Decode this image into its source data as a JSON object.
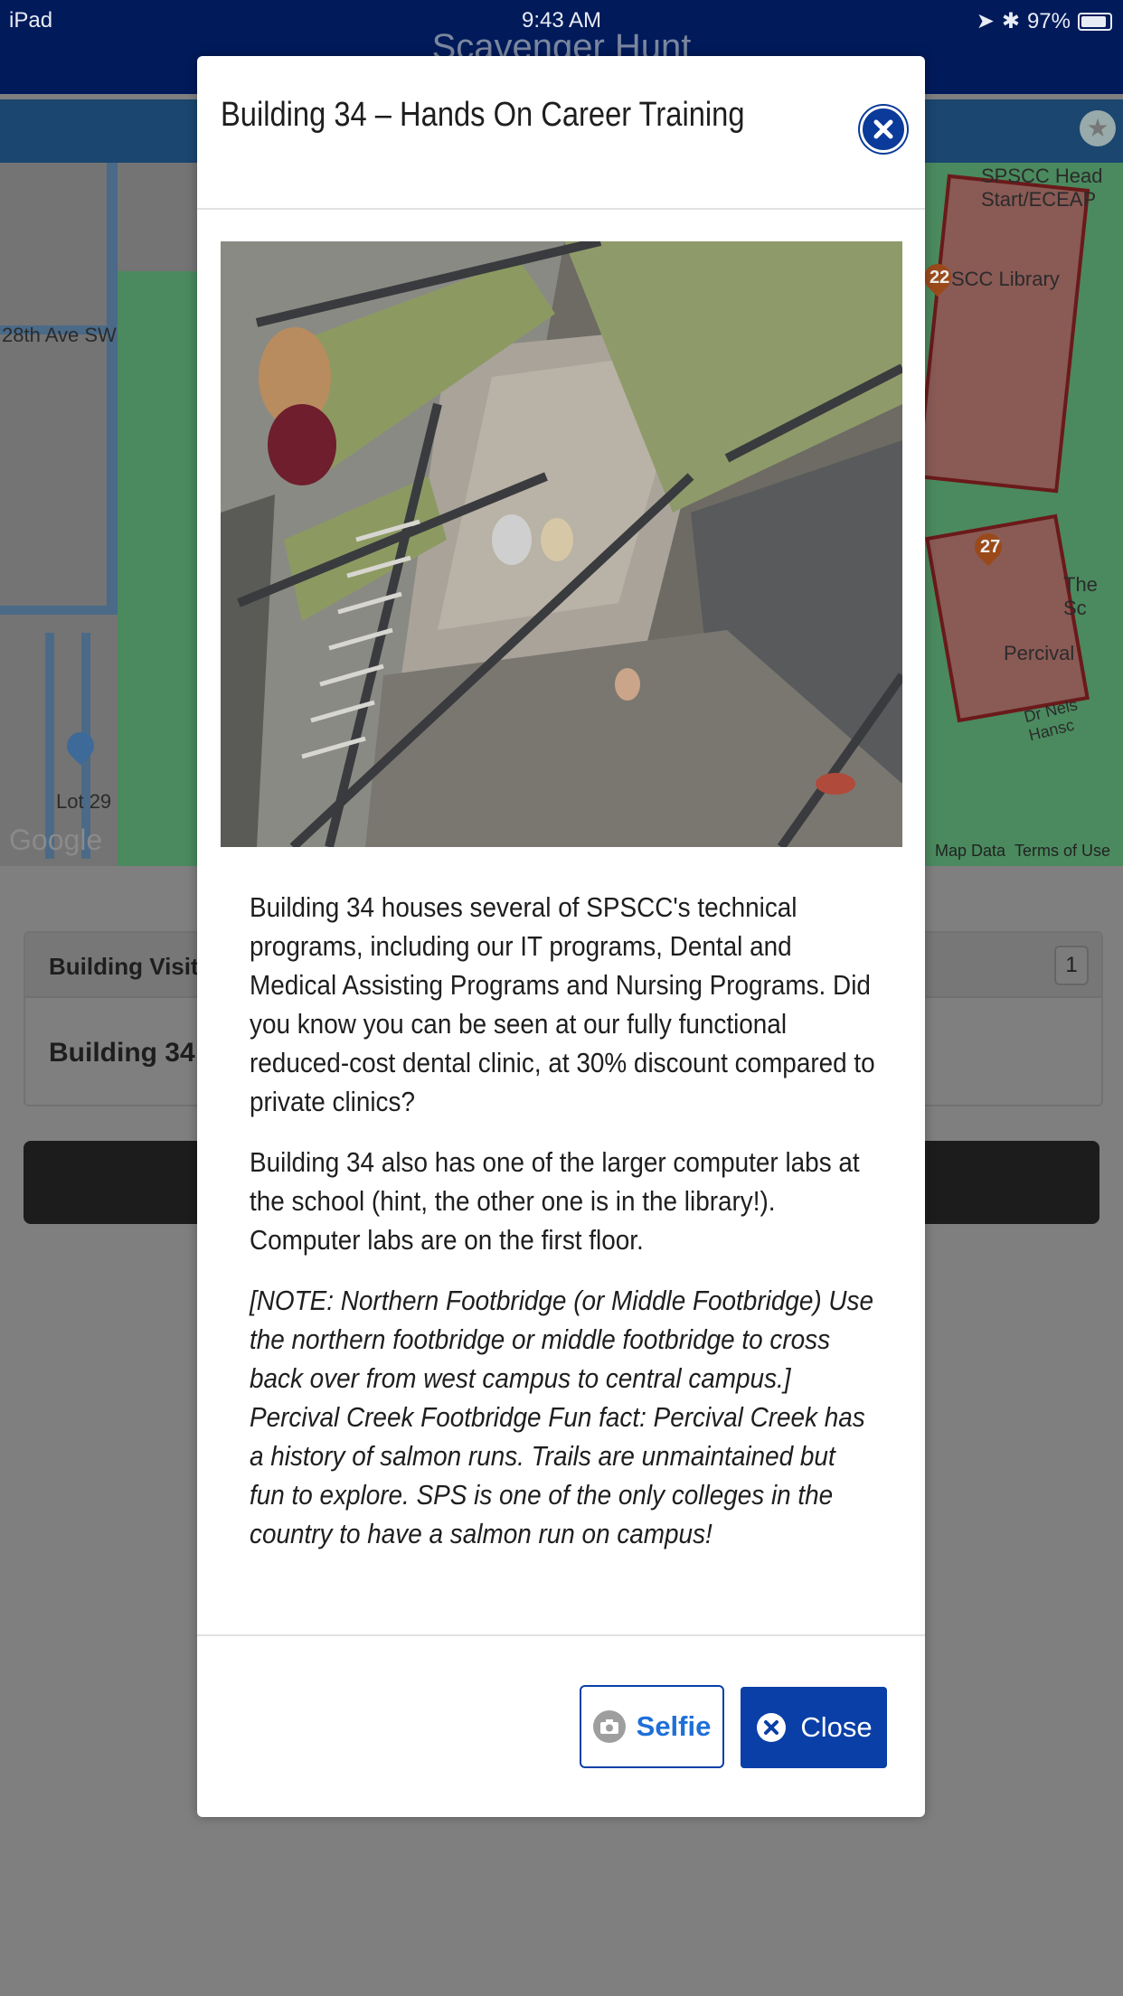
{
  "status_bar": {
    "device": "iPad",
    "time": "9:43 AM",
    "battery": "97%"
  },
  "app": {
    "title": "Scavenger Hunt"
  },
  "map": {
    "labels": [
      "28th Ave SW",
      "Lot 29",
      "SPSCC Head Start/ECEAP",
      "SCC Library",
      "The Sc",
      "Percival",
      "Dr Nels Hansc"
    ],
    "pins": [
      "22",
      "27"
    ],
    "attribution": {
      "google": "Google",
      "map_data": "Map Data",
      "terms": "Terms of Use"
    }
  },
  "visited_panel": {
    "title": "Building Visited",
    "count": "1",
    "row": "Building 34"
  },
  "modal": {
    "title": "Building 34 – Hands On Career Training",
    "paragraphs": [
      "Building 34 houses several of SPSCC's technical programs, including our IT programs, Dental and Medical Assisting Programs and Nursing Programs. Did you know you can be seen at our fully functional reduced-cost dental clinic, at 30% discount compared to private clinics?",
      "Building 34 also has one of the larger computer labs at the school (hint, the other one is in the library!). Computer labs are on the first floor."
    ],
    "note": "[NOTE: Northern Footbridge (or Middle Footbridge) Use the northern footbridge or middle footbridge to cross back over from west campus to central campus.] Percival Creek Footbridge Fun fact: Percival Creek has a history of salmon runs. Trails are unmaintained but fun to explore. SPS is one of the only colleges in the country to have a salmon run on campus!",
    "buttons": {
      "selfie": "Selfie",
      "close": "Close"
    }
  },
  "colors": {
    "primary": "#0a3fa8",
    "nav": "#001a5a",
    "overlay": "#7f7f7f"
  }
}
